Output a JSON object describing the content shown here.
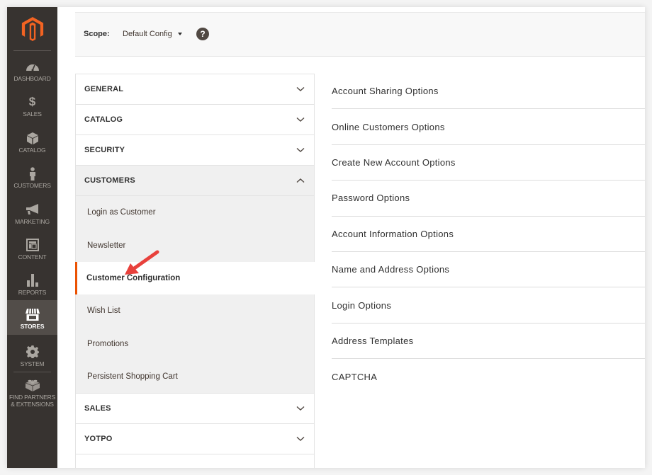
{
  "nav": {
    "logo": "magento-logo",
    "items": [
      {
        "label": "DASHBOARD",
        "icon": "dashboard-icon"
      },
      {
        "label": "SALES",
        "icon": "dollar-icon"
      },
      {
        "label": "CATALOG",
        "icon": "box-icon"
      },
      {
        "label": "CUSTOMERS",
        "icon": "person-icon"
      },
      {
        "label": "MARKETING",
        "icon": "megaphone-icon"
      },
      {
        "label": "CONTENT",
        "icon": "layout-icon"
      },
      {
        "label": "REPORTS",
        "icon": "bar-chart-icon"
      },
      {
        "label": "STORES",
        "icon": "storefront-icon",
        "active": true
      },
      {
        "label": "SYSTEM",
        "icon": "gear-icon"
      },
      {
        "label": "FIND PARTNERS & EXTENSIONS",
        "icon": "lego-brick-icon"
      }
    ],
    "active_color": "#524d49",
    "bg_color": "#373330"
  },
  "scope": {
    "label": "Scope:",
    "value": "Default Config",
    "help": "?"
  },
  "config_tabs": [
    {
      "title": "GENERAL",
      "expanded": false
    },
    {
      "title": "CATALOG",
      "expanded": false
    },
    {
      "title": "SECURITY",
      "expanded": false
    },
    {
      "title": "CUSTOMERS",
      "expanded": true,
      "items": [
        "Login as Customer",
        "Newsletter",
        "Customer Configuration",
        "Wish List",
        "Promotions",
        "Persistent Shopping Cart"
      ],
      "active_item": "Customer Configuration"
    },
    {
      "title": "SALES",
      "expanded": false
    },
    {
      "title": "YOTPO",
      "expanded": false
    }
  ],
  "sections": [
    "Account Sharing Options",
    "Online Customers Options",
    "Create New Account Options",
    "Password Options",
    "Account Information Options",
    "Name and Address Options",
    "Login Options",
    "Address Templates",
    "CAPTCHA"
  ],
  "accent_color": "#eb5202",
  "annotation_arrow_color": "#e8413c"
}
